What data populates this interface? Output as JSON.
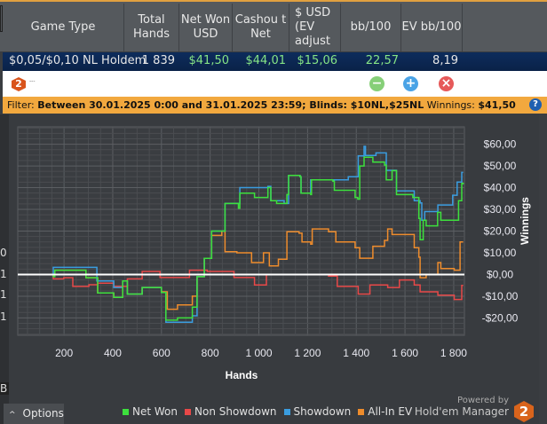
{
  "table": {
    "headers": [
      "Game Type",
      "Total Hands",
      "Net Won USD",
      "Cashou t Net",
      "$ USD (EV adjust",
      "bb/100",
      "EV bb/100"
    ],
    "row": {
      "game_type": "$0,05/$0,10 NL Holdem",
      "total_hands": "1 839",
      "net_won": "$41,50",
      "cashout_net": "$44,01",
      "usd_ev": "$15,06",
      "bb100": "22,57",
      "ev_bb100": "8,19"
    }
  },
  "toolbar": {
    "logo": "2",
    "title": "---",
    "minus": "−",
    "plus": "+",
    "close": "×"
  },
  "filter": {
    "label": "Filter:",
    "text": "Between 30.01.2025 0:00 and 31.01.2025 23:59; Blinds: $10NL,$25NL",
    "winnings_label": "Winnings:",
    "winnings": "$41,50",
    "help": "?"
  },
  "left_strip": [
    "0",
    "1",
    "1",
    "1",
    "B"
  ],
  "options_label": "Options",
  "options_icon": "chevron-up",
  "powered": {
    "line1": "Powered by",
    "line2": "Hold'em Manager",
    "badge": "2"
  },
  "chart_data": {
    "type": "line",
    "xlabel": "Hands",
    "ylabel": "Winnings",
    "xlim": [
      10,
      1844
    ],
    "ylim": [
      -28,
      68
    ],
    "xticks": [
      200,
      400,
      600,
      800,
      1000,
      1200,
      1400,
      1600,
      1800
    ],
    "xtick_labels": [
      "200",
      "400",
      "600",
      "800",
      "1 000",
      "1 200",
      "1 400",
      "1 600",
      "1 800"
    ],
    "yticks": [
      -20,
      -10,
      0,
      10,
      20,
      30,
      40,
      50,
      60
    ],
    "ytick_labels": [
      "-$20,00",
      "-$10,00",
      "$0,00",
      "$10,00",
      "$20,00",
      "$30,00",
      "$40,00",
      "$50,00",
      "$60,00"
    ],
    "grid": true,
    "legend": "bottom",
    "series": [
      {
        "name": "Net Won",
        "color": "#3de03d",
        "points": [
          [
            10,
            0
          ],
          [
            156,
            -1
          ],
          [
            162,
            2
          ],
          [
            229,
            2
          ],
          [
            290,
            -1.5
          ],
          [
            338,
            -8.5
          ],
          [
            404,
            -10.5
          ],
          [
            441,
            -3
          ],
          [
            460,
            -9
          ],
          [
            521,
            -6
          ],
          [
            600,
            -8.3
          ],
          [
            618,
            -21
          ],
          [
            666,
            -20
          ],
          [
            727,
            -15
          ],
          [
            746,
            -1
          ],
          [
            776,
            7.4
          ],
          [
            806,
            20
          ],
          [
            842,
            20
          ],
          [
            861,
            32.7
          ],
          [
            916,
            30.5
          ],
          [
            922,
            37.5
          ],
          [
            982,
            35.5
          ],
          [
            1037,
            40
          ],
          [
            1049,
            34
          ],
          [
            1073,
            32.7
          ],
          [
            1104,
            32.7
          ],
          [
            1115,
            36.8
          ],
          [
            1122,
            45.6
          ],
          [
            1169,
            45
          ],
          [
            1173,
            37.5
          ],
          [
            1213,
            36.8
          ],
          [
            1216,
            43.6
          ],
          [
            1304,
            43
          ],
          [
            1310,
            38.8
          ],
          [
            1395,
            35.5
          ],
          [
            1406,
            34.7
          ],
          [
            1414,
            50
          ],
          [
            1432,
            54
          ],
          [
            1468,
            51.8
          ],
          [
            1516,
            50.4
          ],
          [
            1523,
            43.6
          ],
          [
            1547,
            47.8
          ],
          [
            1565,
            36.8
          ],
          [
            1632,
            35.5
          ],
          [
            1657,
            25.8
          ],
          [
            1662,
            16
          ],
          [
            1675,
            25
          ],
          [
            1687,
            22.4
          ],
          [
            1734,
            28.6
          ],
          [
            1747,
            25
          ],
          [
            1796,
            25
          ],
          [
            1820,
            34
          ],
          [
            1833,
            42
          ],
          [
            1839,
            41.5
          ]
        ]
      },
      {
        "name": "Non Showdown",
        "color": "#e84848",
        "points": [
          [
            10,
            0
          ],
          [
            156,
            -2
          ],
          [
            199,
            -1.5
          ],
          [
            236,
            -5.5
          ],
          [
            302,
            -4.7
          ],
          [
            338,
            -4
          ],
          [
            404,
            -5.5
          ],
          [
            460,
            -2
          ],
          [
            521,
            1.4
          ],
          [
            594,
            -1.4
          ],
          [
            715,
            2
          ],
          [
            788,
            1.4
          ],
          [
            898,
            -1.4
          ],
          [
            982,
            -4.8
          ],
          [
            1031,
            0
          ],
          [
            1213,
            0
          ],
          [
            1286,
            -0.7
          ],
          [
            1322,
            -5.5
          ],
          [
            1408,
            -9
          ],
          [
            1456,
            -4.8
          ],
          [
            1529,
            -6
          ],
          [
            1577,
            -2.5
          ],
          [
            1638,
            -4.8
          ],
          [
            1662,
            -8
          ],
          [
            1735,
            -9.5
          ],
          [
            1802,
            -11.5
          ],
          [
            1833,
            -5
          ],
          [
            1839,
            -5
          ]
        ]
      },
      {
        "name": "Showdown",
        "color": "#3a9de0",
        "points": [
          [
            10,
            0
          ],
          [
            156,
            3.3
          ],
          [
            290,
            3.3
          ],
          [
            335,
            -3
          ],
          [
            404,
            -6
          ],
          [
            441,
            -3
          ],
          [
            460,
            -9
          ],
          [
            521,
            -6
          ],
          [
            600,
            -8.3
          ],
          [
            618,
            -22
          ],
          [
            727,
            -19
          ],
          [
            746,
            -1
          ],
          [
            776,
            7.4
          ],
          [
            806,
            20
          ],
          [
            842,
            20
          ],
          [
            861,
            32.7
          ],
          [
            916,
            32.7
          ],
          [
            922,
            40
          ],
          [
            1037,
            40.6
          ],
          [
            1049,
            34
          ],
          [
            1104,
            32.7
          ],
          [
            1122,
            45.6
          ],
          [
            1169,
            45
          ],
          [
            1173,
            37.5
          ],
          [
            1213,
            43.6
          ],
          [
            1367,
            45
          ],
          [
            1402,
            45
          ],
          [
            1408,
            54.6
          ],
          [
            1432,
            59
          ],
          [
            1438,
            54.8
          ],
          [
            1481,
            56
          ],
          [
            1516,
            56
          ],
          [
            1523,
            48
          ],
          [
            1565,
            38.5
          ],
          [
            1632,
            38.5
          ],
          [
            1638,
            34
          ],
          [
            1662,
            33
          ],
          [
            1669,
            25
          ],
          [
            1681,
            29
          ],
          [
            1711,
            29
          ],
          [
            1735,
            32
          ],
          [
            1796,
            36.5
          ],
          [
            1814,
            42.6
          ],
          [
            1833,
            47
          ],
          [
            1839,
            47
          ]
        ]
      },
      {
        "name": "All-In EV",
        "color": "#ee8c2c",
        "points": [
          [
            10,
            0
          ],
          [
            156,
            -1
          ],
          [
            162,
            2
          ],
          [
            229,
            2
          ],
          [
            290,
            -1.5
          ],
          [
            338,
            -8.5
          ],
          [
            404,
            -10.5
          ],
          [
            441,
            -3
          ],
          [
            460,
            -9
          ],
          [
            521,
            -6
          ],
          [
            600,
            -8
          ],
          [
            624,
            -16
          ],
          [
            666,
            -14
          ],
          [
            727,
            -10
          ],
          [
            746,
            -1
          ],
          [
            776,
            7.4
          ],
          [
            806,
            18
          ],
          [
            848,
            20
          ],
          [
            861,
            10.5
          ],
          [
            910,
            10
          ],
          [
            970,
            5.5
          ],
          [
            1019,
            10
          ],
          [
            1043,
            4
          ],
          [
            1080,
            7
          ],
          [
            1115,
            19.7
          ],
          [
            1165,
            19
          ],
          [
            1177,
            15
          ],
          [
            1213,
            14
          ],
          [
            1219,
            21
          ],
          [
            1286,
            19.7
          ],
          [
            1316,
            15
          ],
          [
            1395,
            12.3
          ],
          [
            1414,
            7.5
          ],
          [
            1468,
            13
          ],
          [
            1516,
            15.7
          ],
          [
            1529,
            21
          ],
          [
            1547,
            18.4
          ],
          [
            1620,
            18.4
          ],
          [
            1638,
            12.3
          ],
          [
            1657,
            8
          ],
          [
            1662,
            -1.5
          ],
          [
            1687,
            0
          ],
          [
            1735,
            5.5
          ],
          [
            1747,
            2.7
          ],
          [
            1802,
            2
          ],
          [
            1826,
            15
          ],
          [
            1839,
            15
          ]
        ]
      }
    ]
  }
}
